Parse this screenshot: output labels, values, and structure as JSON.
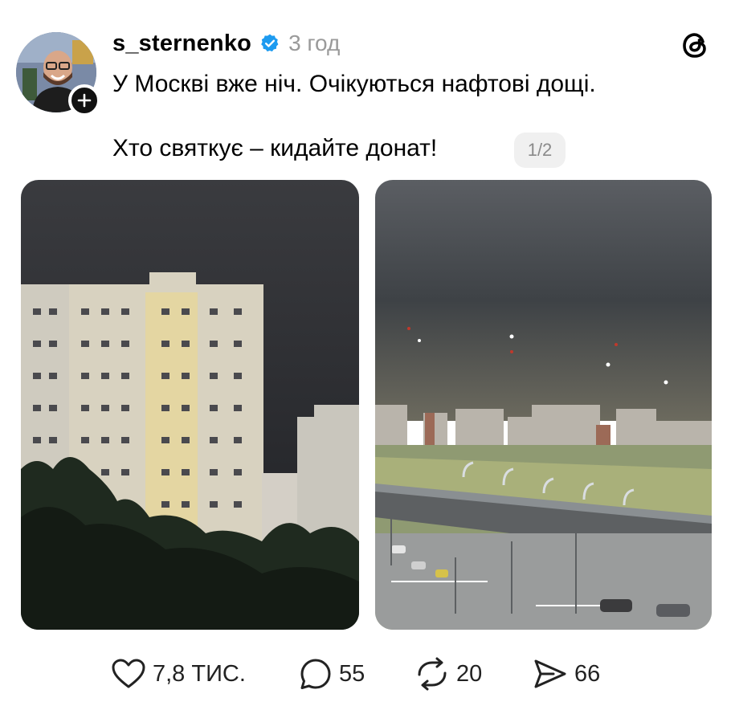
{
  "post": {
    "username": "s_sternenko",
    "time": "3 год",
    "text_line1": "У Москві вже ніч. Очікуються нафтові дощі.",
    "text_line2": "Хто святкує – кидайте донат!",
    "page_indicator": "1/2"
  },
  "actions": {
    "likes": "7,8 ТИС.",
    "replies": "55",
    "reposts": "20",
    "shares": "66"
  },
  "icons": {
    "verified": "verified-badge-icon",
    "threads": "threads-logo-icon",
    "follow": "plus-icon",
    "like": "heart-icon",
    "reply": "speech-bubble-icon",
    "repost": "repost-icon",
    "share": "send-icon"
  },
  "colors": {
    "verified": "#1d9bf0",
    "muted_text": "#9a9a9a",
    "badge_bg": "#f0f0f0"
  }
}
